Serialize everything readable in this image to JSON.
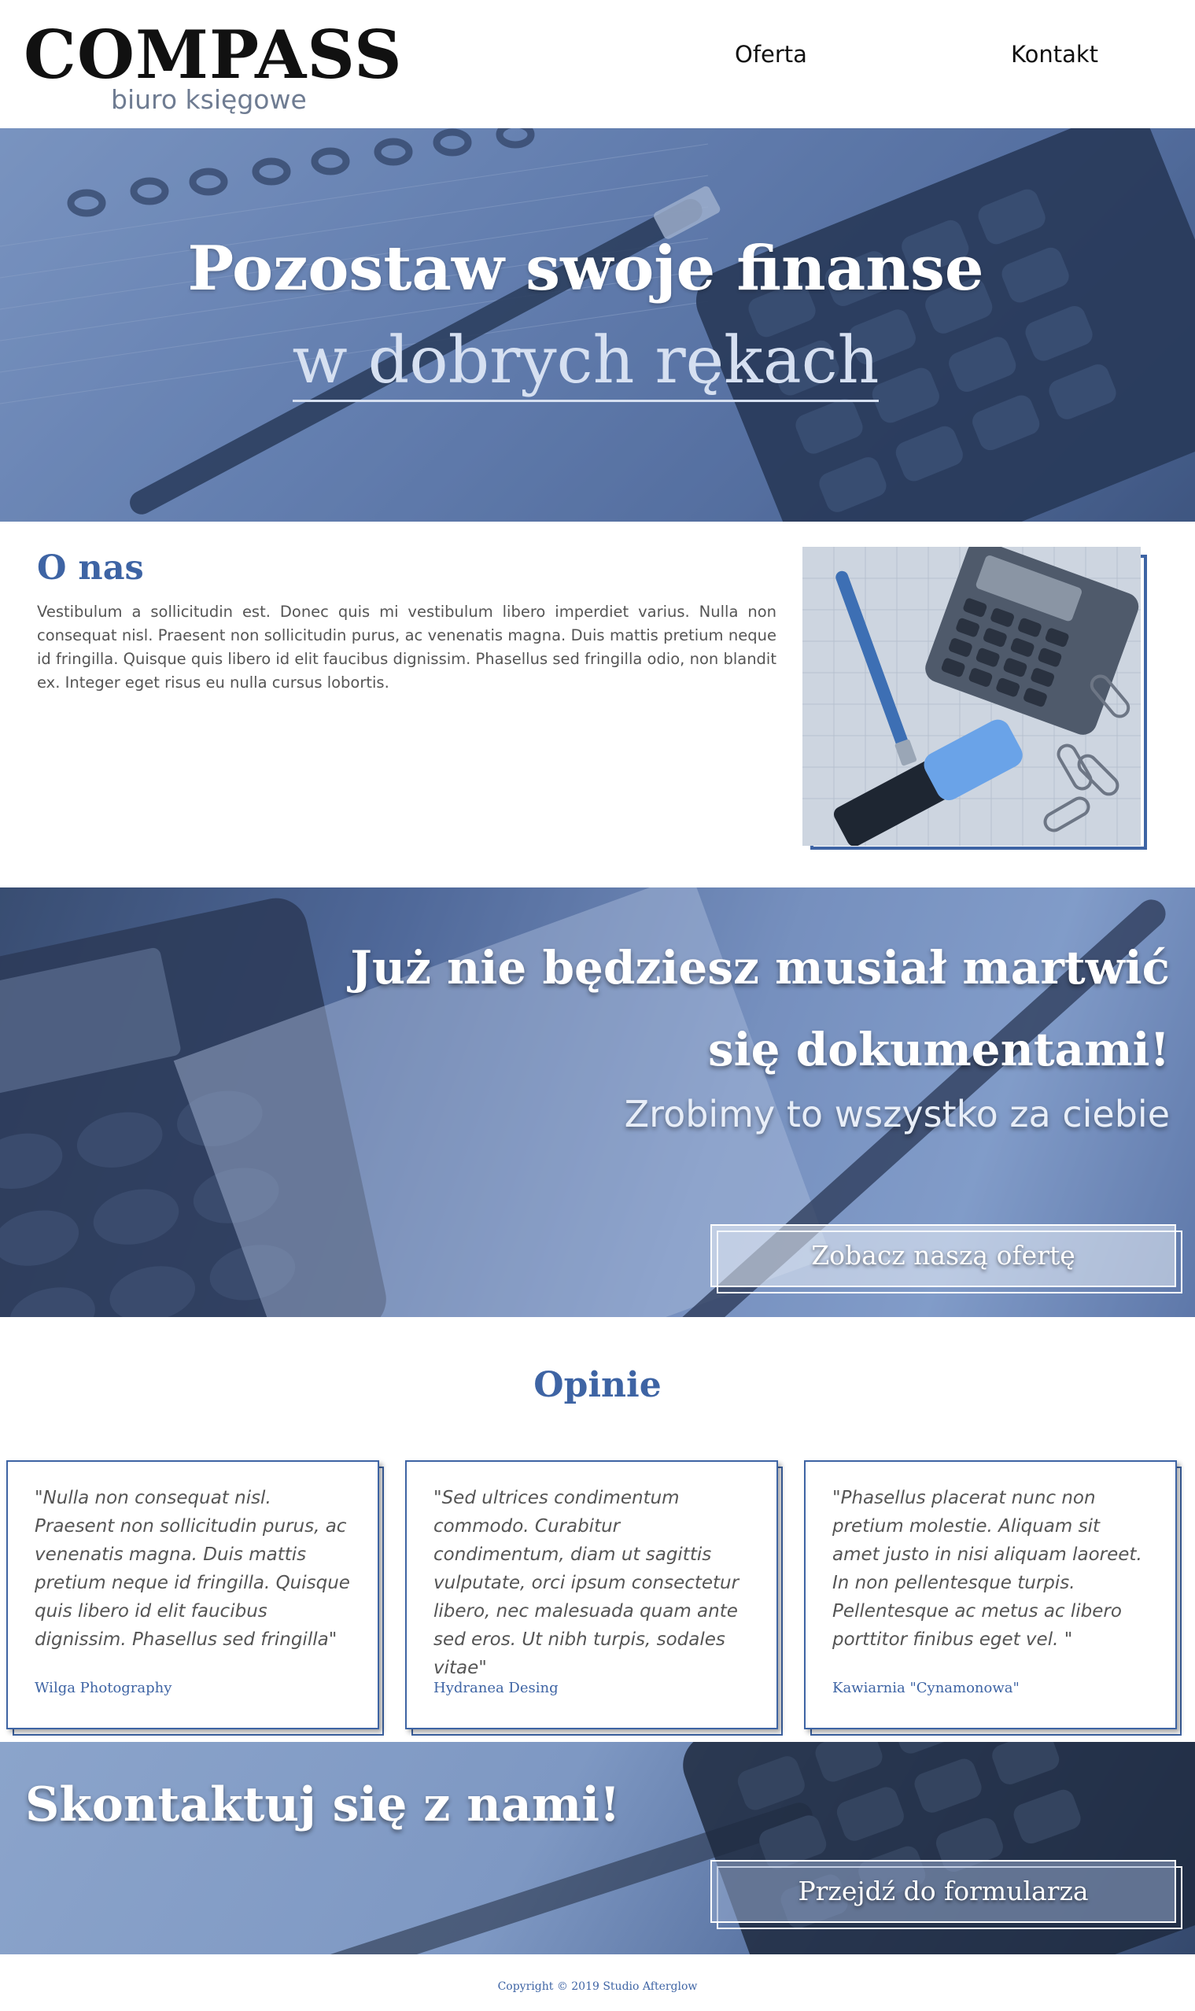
{
  "header": {
    "logo_main": "COMPASS",
    "logo_sub": "biuro księgowe",
    "nav": [
      {
        "label": "Oferta"
      },
      {
        "label": "Kontakt"
      }
    ]
  },
  "hero": {
    "line1": "Pozostaw swoje finanse",
    "line2": "w dobrych rękach"
  },
  "about": {
    "title": "O nas",
    "text": "Vestibulum a sollicitudin est. Donec quis mi vestibulum libero imperdiet varius. Nulla non consequat nisl. Praesent non sollicitudin purus, ac venenatis magna. Duis mattis pretium neque id fringilla. Quisque quis libero id elit faucibus dignissim. Phasellus sed fringilla odio, non blandit ex. Integer eget risus eu nulla cursus lobortis."
  },
  "banner": {
    "headline": "Już nie będziesz musiał martwić się dokumentami!",
    "subline": "Zrobimy to wszystko za ciebie",
    "button_label": "Zobacz naszą ofertę"
  },
  "reviews": {
    "title": "Opinie",
    "items": [
      {
        "quote": "\"Nulla non consequat nisl. Praesent non sollicitudin purus, ac venenatis magna. Duis mattis pretium neque id fringilla. Quisque quis libero id elit faucibus dignissim. Phasellus sed fringilla\"",
        "author": "Wilga Photography"
      },
      {
        "quote": "\"Sed ultrices condimentum commodo. Curabitur condimentum, diam ut sagittis vulputate, orci ipsum consectetur libero, nec malesuada quam ante sed eros. Ut nibh turpis, sodales vitae\"",
        "author": "Hydranea Desing"
      },
      {
        "quote": "\"Phasellus placerat nunc non pretium molestie. Aliquam sit amet justo in nisi aliquam laoreet. In non pellentesque turpis. Pellentesque ac metus ac libero porttitor finibus eget vel. \"",
        "author": "Kawiarnia \"Cynamonowa\""
      }
    ]
  },
  "contact": {
    "title": "Skontaktuj się z nami!",
    "button_label": "Przejdź do formularza"
  },
  "footer": {
    "copyright": "Copyright © 2019 Studio Afterglow"
  },
  "colors": {
    "accent": "#3e64a4",
    "hero_tint": "#6f88b4",
    "text": "#555555"
  },
  "icons": [
    "calculator-image",
    "notebook-pen-image",
    "paperclips-image"
  ]
}
